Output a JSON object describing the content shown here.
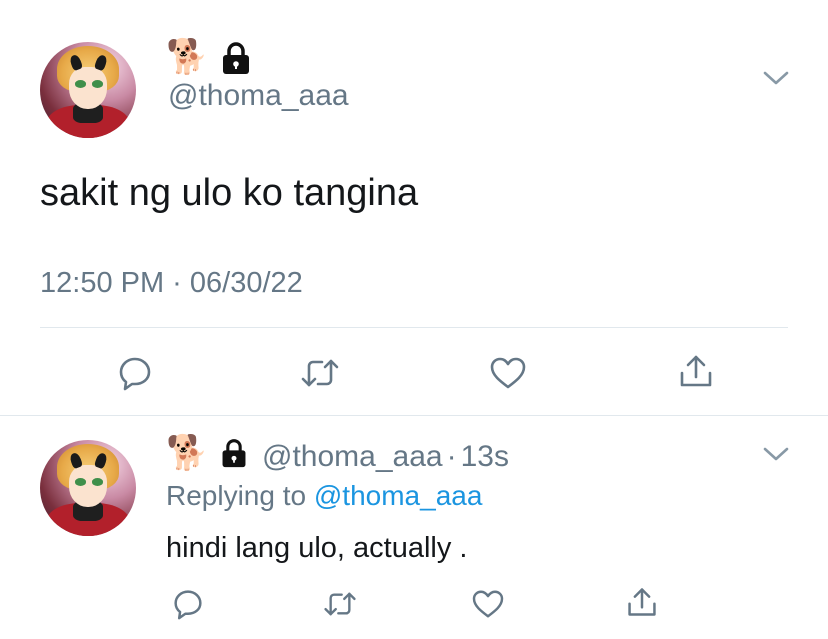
{
  "tweet": {
    "author_emoji": "🐕",
    "lock_icon": "lock-icon",
    "handle": "@thoma_aaa",
    "text": "sakit ng ulo ko tangina",
    "timestamp": "12:50 PM · 06/30/22",
    "actions": [
      "reply-icon",
      "retweet-icon",
      "like-icon",
      "share-icon"
    ]
  },
  "reply": {
    "author_emoji": "🐕",
    "handle": "@thoma_aaa",
    "time_sep": "·",
    "time": "13s",
    "replying_prefix": "Replying to ",
    "replying_to": "@thoma_aaa",
    "text": "hindi lang ulo, actually .",
    "actions": [
      "reply-icon",
      "retweet-icon",
      "like-icon",
      "share-icon"
    ]
  },
  "colors": {
    "secondary_text": "#657786",
    "link": "#1b95e0",
    "icon": "#657786",
    "divider": "#e1e8ed"
  }
}
